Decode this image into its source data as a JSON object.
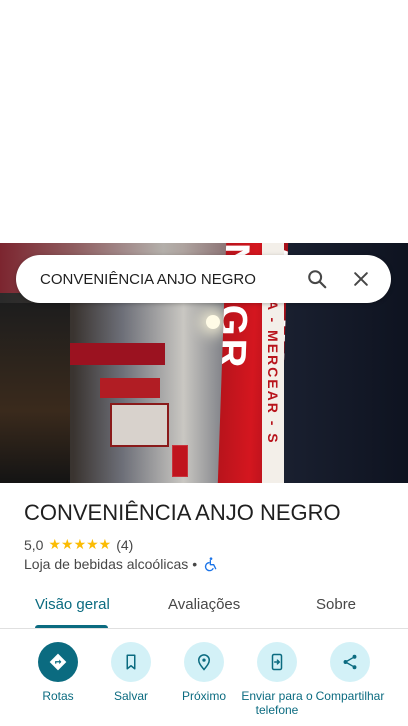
{
  "search": {
    "query": "CONVENIÊNCIA ANJO NEGRO"
  },
  "photo": {
    "banner_text": "ANJO NEGR",
    "strip_text": "CIA - MERCEAR - S"
  },
  "place": {
    "name": "CONVENIÊNCIA ANJO NEGRO",
    "rating": "5,0",
    "stars": "★★★★★",
    "review_count": "(4)",
    "category": "Loja de bebidas alcoólicas",
    "separator": "•"
  },
  "tabs": [
    {
      "label": "Visão geral"
    },
    {
      "label": "Avaliações"
    },
    {
      "label": "Sobre"
    }
  ],
  "actions": [
    {
      "label": "Rotas"
    },
    {
      "label": "Salvar"
    },
    {
      "label": "Próximo"
    },
    {
      "label": "Enviar para o telefone"
    },
    {
      "label": "Compartilhar"
    }
  ],
  "colors": {
    "accent": "#0b6b80",
    "accent_light": "#d3f1f7",
    "star": "#fbbc04"
  }
}
